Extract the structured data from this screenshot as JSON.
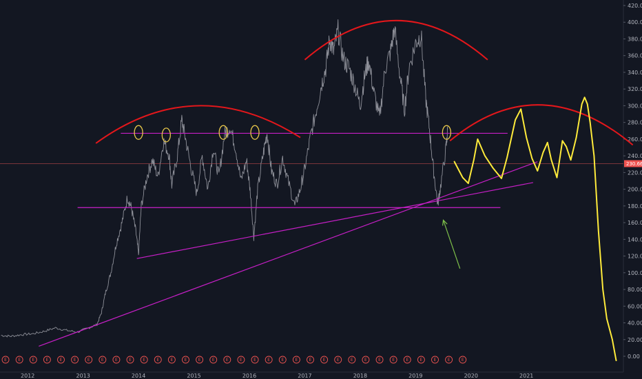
{
  "chart_data": {
    "type": "line",
    "title": "",
    "xlabel": "",
    "ylabel": "",
    "x_range": [
      2011.5,
      2022.75
    ],
    "ylim": [
      -10,
      430
    ],
    "y_ticks": [
      "0.00",
      "20.00",
      "40.00",
      "60.00",
      "80.00",
      "100.00",
      "120.00",
      "140.00",
      "160.00",
      "180.00",
      "200.00",
      "220.00",
      "240.00",
      "260.00",
      "280.00",
      "300.00",
      "320.00",
      "340.00",
      "360.00",
      "380.00",
      "400.00",
      "420.00"
    ],
    "x_ticks": [
      "2012",
      "2013",
      "2014",
      "2015",
      "2016",
      "2017",
      "2018",
      "2019",
      "2020",
      "2021"
    ],
    "current_price_label": "230.66",
    "current_price": 230.66,
    "grid": false,
    "legend": "none",
    "earnings_marker_label": "E",
    "earnings_markers_x": [
      2011.6,
      2011.85,
      2012.1,
      2012.35,
      2012.6,
      2012.85,
      2013.1,
      2013.35,
      2013.6,
      2013.85,
      2014.1,
      2014.35,
      2014.6,
      2014.85,
      2015.1,
      2015.35,
      2015.6,
      2015.85,
      2016.1,
      2016.35,
      2016.6,
      2016.85,
      2017.1,
      2017.35,
      2017.6,
      2017.85,
      2018.1,
      2018.35,
      2018.6,
      2018.85,
      2019.1,
      2019.35,
      2019.6,
      2019.85
    ],
    "price_series": [
      [
        2011.52,
        25
      ],
      [
        2011.7,
        24
      ],
      [
        2011.9,
        26
      ],
      [
        2012.1,
        27
      ],
      [
        2012.3,
        30
      ],
      [
        2012.5,
        34
      ],
      [
        2012.7,
        31
      ],
      [
        2012.9,
        29
      ],
      [
        2013.1,
        34
      ],
      [
        2013.25,
        38
      ],
      [
        2013.33,
        52
      ],
      [
        2013.4,
        75
      ],
      [
        2013.5,
        100
      ],
      [
        2013.6,
        135
      ],
      [
        2013.7,
        160
      ],
      [
        2013.8,
        190
      ],
      [
        2013.87,
        178
      ],
      [
        2013.95,
        150
      ],
      [
        2014.0,
        122
      ],
      [
        2014.05,
        180
      ],
      [
        2014.15,
        215
      ],
      [
        2014.25,
        235
      ],
      [
        2014.35,
        215
      ],
      [
        2014.45,
        258
      ],
      [
        2014.55,
        242
      ],
      [
        2014.6,
        205
      ],
      [
        2014.7,
        240
      ],
      [
        2014.78,
        283
      ],
      [
        2014.85,
        260
      ],
      [
        2014.95,
        225
      ],
      [
        2015.05,
        195
      ],
      [
        2015.15,
        240
      ],
      [
        2015.25,
        200
      ],
      [
        2015.35,
        250
      ],
      [
        2015.45,
        215
      ],
      [
        2015.55,
        265
      ],
      [
        2015.65,
        275
      ],
      [
        2015.75,
        250
      ],
      [
        2015.85,
        210
      ],
      [
        2015.95,
        235
      ],
      [
        2016.02,
        195
      ],
      [
        2016.08,
        143
      ],
      [
        2016.15,
        200
      ],
      [
        2016.25,
        242
      ],
      [
        2016.32,
        268
      ],
      [
        2016.4,
        222
      ],
      [
        2016.5,
        205
      ],
      [
        2016.6,
        238
      ],
      [
        2016.7,
        210
      ],
      [
        2016.82,
        180
      ],
      [
        2016.92,
        200
      ],
      [
        2017.0,
        225
      ],
      [
        2017.1,
        262
      ],
      [
        2017.2,
        292
      ],
      [
        2017.3,
        325
      ],
      [
        2017.38,
        345
      ],
      [
        2017.45,
        380
      ],
      [
        2017.52,
        365
      ],
      [
        2017.6,
        390
      ],
      [
        2017.7,
        355
      ],
      [
        2017.8,
        345
      ],
      [
        2017.9,
        325
      ],
      [
        2018.0,
        300
      ],
      [
        2018.08,
        335
      ],
      [
        2018.15,
        355
      ],
      [
        2018.25,
        315
      ],
      [
        2018.35,
        285
      ],
      [
        2018.45,
        345
      ],
      [
        2018.55,
        365
      ],
      [
        2018.62,
        393
      ],
      [
        2018.72,
        335
      ],
      [
        2018.8,
        295
      ],
      [
        2018.88,
        345
      ],
      [
        2019.0,
        375
      ],
      [
        2019.1,
        385
      ],
      [
        2019.18,
        310
      ],
      [
        2019.25,
        272
      ],
      [
        2019.32,
        225
      ],
      [
        2019.4,
        182
      ],
      [
        2019.45,
        203
      ],
      [
        2019.55,
        250
      ],
      [
        2019.58,
        272
      ]
    ],
    "projection_path": [
      [
        2019.7,
        233
      ],
      [
        2019.85,
        214
      ],
      [
        2019.95,
        207
      ],
      [
        2020.05,
        235
      ],
      [
        2020.12,
        260
      ],
      [
        2020.25,
        240
      ],
      [
        2020.4,
        225
      ],
      [
        2020.55,
        213
      ],
      [
        2020.65,
        238
      ],
      [
        2020.8,
        283
      ],
      [
        2020.9,
        296
      ],
      [
        2021.0,
        262
      ],
      [
        2021.1,
        237
      ],
      [
        2021.2,
        222
      ],
      [
        2021.3,
        244
      ],
      [
        2021.38,
        256
      ],
      [
        2021.45,
        235
      ],
      [
        2021.55,
        214
      ],
      [
        2021.65,
        258
      ],
      [
        2021.72,
        251
      ],
      [
        2021.8,
        235
      ],
      [
        2021.9,
        262
      ],
      [
        2022.0,
        302
      ],
      [
        2022.05,
        310
      ],
      [
        2022.1,
        302
      ],
      [
        2022.15,
        280
      ],
      [
        2022.22,
        240
      ],
      [
        2022.3,
        150
      ],
      [
        2022.38,
        80
      ],
      [
        2022.45,
        45
      ],
      [
        2022.55,
        20
      ],
      [
        2022.62,
        -5
      ]
    ],
    "annotations": {
      "arcs": [
        {
          "x1": 2013.23,
          "y1": 255,
          "x2": 2016.92,
          "y2": 262,
          "peak_x": 2015.05,
          "peak_y": 300,
          "color": "#e3171b"
        },
        {
          "x1": 2017.0,
          "y1": 355,
          "x2": 2020.3,
          "y2": 355,
          "peak_x": 2018.65,
          "peak_y": 402,
          "color": "#e3171b"
        },
        {
          "x1": 2019.62,
          "y1": 258,
          "x2": 2022.92,
          "y2": 253,
          "peak_x": 2021.25,
          "peak_y": 301,
          "color": "#e3171b"
        }
      ],
      "lines": [
        {
          "x1": 2013.68,
          "y1": 267,
          "x2": 2020.66,
          "y2": 267,
          "color": "#c71fc7"
        },
        {
          "x1": 2012.9,
          "y1": 178,
          "x2": 2020.53,
          "y2": 178,
          "color": "#c71fc7"
        },
        {
          "x1": 2013.97,
          "y1": 117,
          "x2": 2021.12,
          "y2": 208,
          "color": "#c71fc7"
        },
        {
          "x1": 2012.2,
          "y1": 12,
          "x2": 2021.2,
          "y2": 233,
          "color": "#c71fc7"
        }
      ],
      "circles": [
        {
          "x": 2014.0,
          "y": 268,
          "color": "#e9c84a"
        },
        {
          "x": 2014.5,
          "y": 265,
          "color": "#e9c84a"
        },
        {
          "x": 2015.53,
          "y": 268,
          "color": "#e9c84a"
        },
        {
          "x": 2016.1,
          "y": 268,
          "color": "#e9c84a"
        },
        {
          "x": 2019.56,
          "y": 268,
          "color": "#e9c84a"
        }
      ],
      "arrow": {
        "from_x": 2019.8,
        "from_y": 105,
        "to_x": 2019.5,
        "to_y": 163,
        "color": "#7ec04a"
      }
    },
    "colors": {
      "background": "#131722",
      "axis_text": "#b2b5be",
      "price": "#8e9099",
      "projection": "#ffeb3b",
      "current_price_line": "#8a3a3f",
      "current_price_tag": "#ef5350",
      "earnings": "#ef5350"
    }
  }
}
